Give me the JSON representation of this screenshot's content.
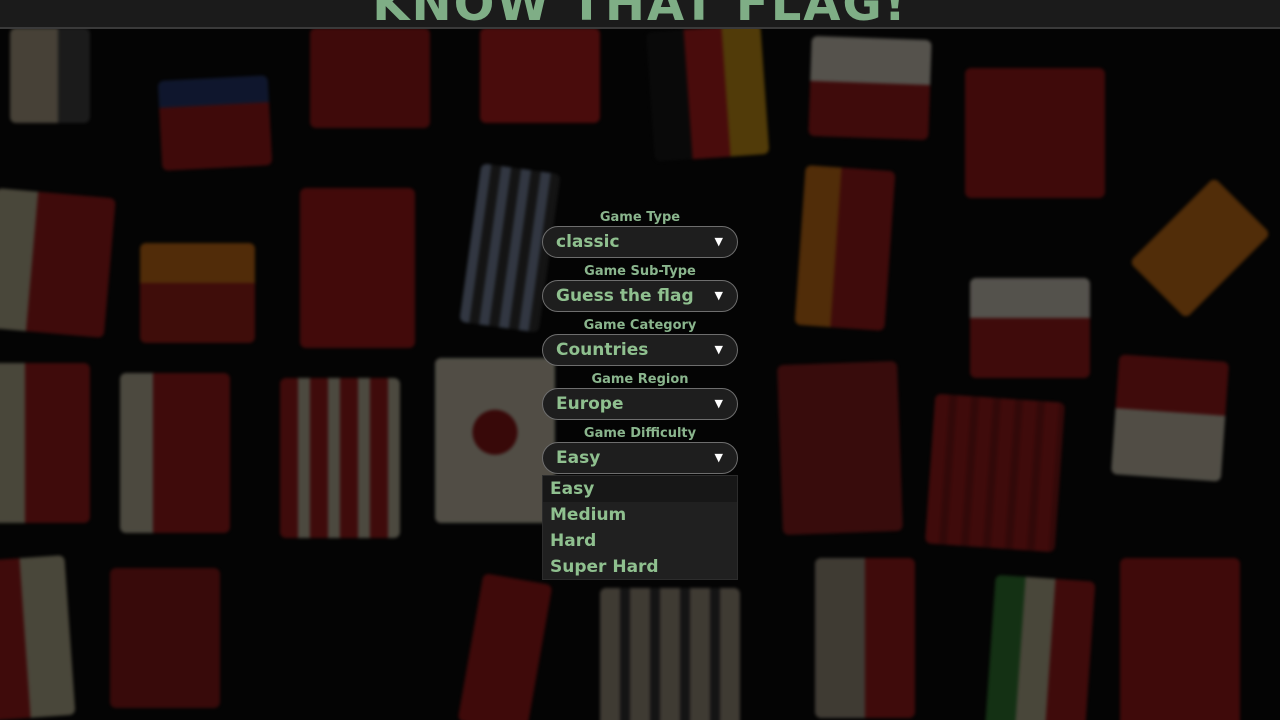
{
  "app": {
    "title": "KNOW THAT FLAG!"
  },
  "form": {
    "game_type": {
      "label": "Game Type",
      "value": "classic"
    },
    "game_sub_type": {
      "label": "Game Sub-Type",
      "value": "Guess the flag"
    },
    "game_category": {
      "label": "Game Category",
      "value": "Countries"
    },
    "game_region": {
      "label": "Game Region",
      "value": "Europe"
    },
    "game_difficulty": {
      "label": "Game Difficulty",
      "value": "Easy"
    }
  },
  "dropdown": {
    "options": [
      "Easy",
      "Medium",
      "Hard",
      "Super Hard"
    ],
    "highlighted": "Easy"
  },
  "icons": {
    "select_arrow": "▼"
  },
  "colors": {
    "accent_text": "#8fc08f",
    "background": "#050505"
  }
}
